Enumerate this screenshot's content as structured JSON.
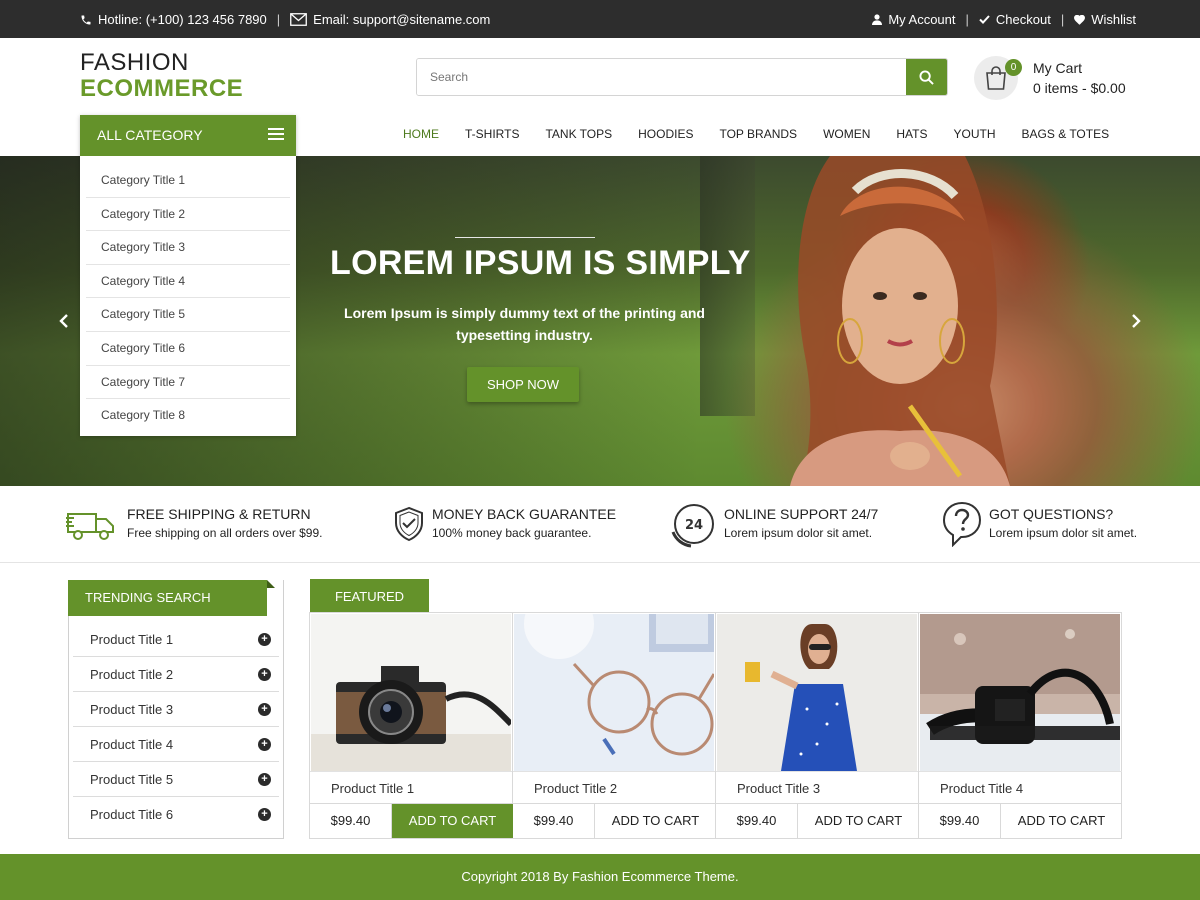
{
  "topbar": {
    "hotline": "Hotline: (+100) 123 456 7890",
    "email": "Email: support@sitename.com",
    "separator": "|",
    "links": [
      "My Account",
      "Checkout",
      "Wishlist"
    ]
  },
  "logo": {
    "line1": "FASHION",
    "line2": "ECOMMERCE"
  },
  "search": {
    "placeholder": "Search"
  },
  "cart": {
    "count": "0",
    "title": "My Cart",
    "summary": "0 items - $0.00"
  },
  "nav": [
    "HOME",
    "T-SHIRTS",
    "TANK TOPS",
    "HOODIES",
    "TOP BRANDS",
    "WOMEN",
    "HATS",
    "YOUTH",
    "BAGS & TOTES"
  ],
  "category": {
    "title": "ALL CATEGORY",
    "items": [
      "Category Title 1",
      "Category Title 2",
      "Category Title 3",
      "Category Title 4",
      "Category Title 5",
      "Category Title 6",
      "Category Title 7",
      "Category Title 8"
    ]
  },
  "hero": {
    "headline": "LOREM IPSUM IS SIMPLY",
    "text": "Lorem Ipsum is simply dummy text of the printing and typesetting industry.",
    "cta": "SHOP NOW"
  },
  "features": [
    {
      "icon": "truck-icon",
      "title": "FREE SHIPPING & RETURN",
      "text": "Free shipping on all orders over $99."
    },
    {
      "icon": "shield-check-icon",
      "title": "MONEY BACK GUARANTEE",
      "text": "100% money back guarantee."
    },
    {
      "icon": "support-24-icon",
      "title": "ONLINE SUPPORT 24/7",
      "text": "Lorem ipsum dolor sit amet."
    },
    {
      "icon": "question-bubble-icon",
      "title": "GOT QUESTIONS?",
      "text": "Lorem ipsum dolor sit amet."
    }
  ],
  "trending": {
    "title": "TRENDING SEARCH",
    "items": [
      "Product Title 1",
      "Product Title 2",
      "Product Title 3",
      "Product Title 4",
      "Product Title 5",
      "Product Title 6"
    ],
    "plus": "+"
  },
  "featured": {
    "tab": "FEATURED",
    "products": [
      {
        "name": "Product Title 1",
        "price": "$99.40",
        "button": "ADD TO CART",
        "image": "camera"
      },
      {
        "name": "Product Title 2",
        "price": "$99.40",
        "button": "ADD TO CART",
        "image": "glasses"
      },
      {
        "name": "Product Title 3",
        "price": "$99.40",
        "button": "ADD TO CART",
        "image": "woman-in-blue-dress"
      },
      {
        "name": "Product Title 4",
        "price": "$99.40",
        "button": "ADD TO CART",
        "image": "headphones"
      }
    ]
  },
  "footer": {
    "copyright": "Copyright 2018 By Fashion Ecommerce Theme."
  },
  "colors": {
    "accent": "#64922a",
    "topbar": "#2d2d2d",
    "footer": "#64922a"
  }
}
